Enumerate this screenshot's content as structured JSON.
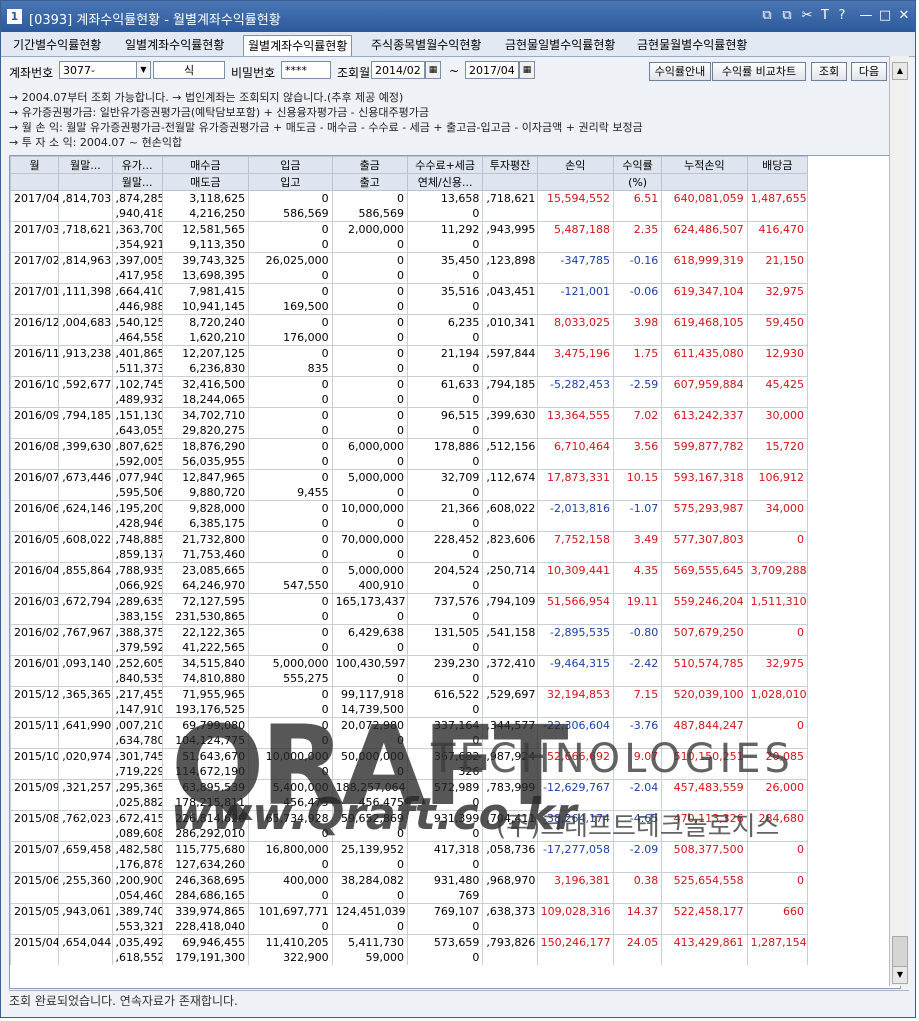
{
  "window": {
    "number": "1",
    "title": "[0393] 계좌수익률현황 - 월별계좌수익률현황",
    "controls": [
      "⧉",
      "⧉",
      "✂",
      "T",
      "?",
      "—",
      "□",
      "✕"
    ]
  },
  "tabs": [
    "기간별수익률현황",
    "일별계좌수익률현황",
    "월별계좌수익률현황",
    "주식종목별월수익현황",
    "금현물일별수익률현황",
    "금현물월별수익률현황"
  ],
  "active_tab": 2,
  "form": {
    "account_label": "계좌번호",
    "account_value": "3077-",
    "name_value": "식",
    "password_label": "비밀번호",
    "password_value": "****",
    "period_label": "조회월",
    "from_value": "2014/02",
    "to_value": "2017/04",
    "tilde": "~",
    "btn_guide": "수익률안내",
    "btn_compare": "수익률 비교차트",
    "btn_search": "조회",
    "btn_next": "다음"
  },
  "notice": [
    "→ 2004.07부터 조회 가능합니다.  → 법인계좌는 조회되지 않습니다.(추후 제공 예정)",
    "→ 유가증권평가금: 일반유가증권평가금(예탁담보포함) + 신용융자평가금 - 신용대주평가금",
    "→ 월    손    익: 월말 유가증권평가금-전월말 유가증권평가금 + 매도금 - 매수금 - 수수료 - 세금 + 출고금-입고금 - 이자금액 + 권리락 보정금",
    "→ 투 자 소 익: 2004.07 ~ 현손익합"
  ],
  "table": {
    "headers_top": [
      "월",
      "월말...",
      "유가...",
      "매수금",
      "입금",
      "출금",
      "수수료+세금",
      "투자평잔",
      "손익",
      "수익률",
      "누적손익",
      "배당금"
    ],
    "headers_bot": [
      "",
      "",
      "월말...",
      "매도금",
      "입고",
      "출고",
      "연체/신용...",
      "",
      "",
      "(%)",
      "",
      ""
    ],
    "rows": [
      [
        "2017/04",
        ",814,703",
        ",874,285",
        "3,118,625",
        "0",
        "0",
        "13,658",
        ",718,621",
        "15,594,552",
        "6.51",
        "640,081,059",
        "1,487,655",
        ",940,418",
        "4,216,250",
        "586,569",
        "586,569",
        "0"
      ],
      [
        "2017/03",
        ",718,621",
        ",363,700",
        "12,581,565",
        "0",
        "2,000,000",
        "11,292",
        ",943,995",
        "5,487,188",
        "2.35",
        "624,486,507",
        "416,470",
        ",354,921",
        "9,113,350",
        "0",
        "0",
        "0"
      ],
      [
        "2017/02",
        ",814,963",
        ",397,005",
        "39,743,325",
        "26,025,000",
        "0",
        "35,450",
        ",123,898",
        "-347,785",
        "-0.16",
        "618,999,319",
        "21,150",
        ",417,958",
        "13,698,395",
        "0",
        "0",
        "0"
      ],
      [
        "2017/01",
        ",111,398",
        ",664,410",
        "7,981,415",
        "0",
        "0",
        "35,516",
        ",043,451",
        "-121,001",
        "-0.06",
        "619,347,104",
        "32,975",
        ",446,988",
        "10,941,145",
        "169,500",
        "0",
        "0"
      ],
      [
        "2016/12",
        ",004,683",
        ",540,125",
        "8,720,240",
        "0",
        "0",
        "6,235",
        ",010,341",
        "8,033,025",
        "3.98",
        "619,468,105",
        "59,450",
        ",464,558",
        "1,620,210",
        "176,000",
        "0",
        "0"
      ],
      [
        "2016/11",
        ",913,238",
        ",401,865",
        "12,207,125",
        "0",
        "0",
        "21,194",
        ",597,844",
        "3,475,196",
        "1.75",
        "611,435,080",
        "12,930",
        ",511,373",
        "6,236,830",
        "835",
        "0",
        "0"
      ],
      [
        "2016/10",
        ",592,677",
        ",102,745",
        "32,416,500",
        "0",
        "0",
        "61,633",
        ",794,185",
        "-5,282,453",
        "-2.59",
        "607,959,884",
        "45,425",
        ",489,932",
        "18,244,065",
        "0",
        "0",
        "0"
      ],
      [
        "2016/09",
        ",794,185",
        ",151,130",
        "34,702,710",
        "0",
        "0",
        "96,515",
        ",399,630",
        "13,364,555",
        "7.02",
        "613,242,337",
        "30,000",
        ",643,055",
        "29,820,275",
        "0",
        "0",
        "0"
      ],
      [
        "2016/08",
        ",399,630",
        ",807,625",
        "18,876,290",
        "0",
        "6,000,000",
        "178,886",
        ",512,156",
        "6,710,464",
        "3.56",
        "599,877,782",
        "15,720",
        ",592,005",
        "56,035,955",
        "0",
        "0",
        "0"
      ],
      [
        "2016/07",
        ",673,446",
        ",077,940",
        "12,847,965",
        "0",
        "5,000,000",
        "32,709",
        ",112,674",
        "17,873,331",
        "10.15",
        "593,167,318",
        "106,912",
        ",595,506",
        "9,880,720",
        "9,455",
        "0",
        "0"
      ],
      [
        "2016/06",
        ",624,146",
        ",195,200",
        "9,828,000",
        "0",
        "10,000,000",
        "21,366",
        ",608,022",
        "-2,013,816",
        "-1.07",
        "575,293,987",
        "34,000",
        ",428,946",
        "6,385,175",
        "0",
        "0",
        "0"
      ],
      [
        "2016/05",
        ",608,022",
        ",748,885",
        "21,732,800",
        "0",
        "70,000,000",
        "228,452",
        ",823,606",
        "7,752,158",
        "3.49",
        "577,307,803",
        "0",
        ",859,137",
        "71,753,460",
        "0",
        "0",
        "0"
      ],
      [
        "2016/04",
        ",855,864",
        ",788,935",
        "23,085,665",
        "0",
        "5,000,000",
        "204,524",
        ",250,714",
        "10,309,441",
        "4.35",
        "569,555,645",
        "3,709,288",
        ",066,929",
        "64,246,970",
        "547,550",
        "400,910",
        "0"
      ],
      [
        "2016/03",
        ",672,794",
        ",289,635",
        "72,127,595",
        "0",
        "165,173,437",
        "737,576",
        ",794,109",
        "51,566,954",
        "19.11",
        "559,246,204",
        "1,511,310",
        ",383,159",
        "231,530,865",
        "0",
        "0",
        "0"
      ],
      [
        "2016/02",
        ",767,967",
        ",388,375",
        "22,122,365",
        "0",
        "6,429,638",
        "131,505",
        ",541,158",
        "-2,895,535",
        "-0.80",
        "507,679,250",
        "0",
        ",379,592",
        "41,222,565",
        "0",
        "0",
        "0"
      ],
      [
        "2016/01",
        ",093,140",
        ",252,605",
        "34,515,840",
        "5,000,000",
        "100,430,597",
        "239,230",
        ",372,410",
        "-9,464,315",
        "-2.42",
        "510,574,785",
        "32,975",
        ",840,535",
        "74,810,880",
        "555,275",
        "0",
        "0"
      ],
      [
        "2015/12",
        ",365,365",
        ",217,455",
        "71,955,965",
        "0",
        "99,117,918",
        "616,522",
        ",529,697",
        "32,194,853",
        "7.15",
        "520,039,100",
        "1,028,010",
        ",147,910",
        "193,176,525",
        "0",
        "14,739,500",
        "0"
      ],
      [
        "2015/11",
        ",641,990",
        ",007,210",
        "69,799,080",
        "0",
        "20,072,980",
        "337,164",
        ",344,577",
        "-22,306,604",
        "-3.76",
        "487,844,247",
        "0",
        ",634,780",
        "104,124,775",
        "0",
        "0",
        "0"
      ],
      [
        "2015/10",
        ",020,974",
        ",301,745",
        "51,643,670",
        "10,000,000",
        "50,000,000",
        "367,682",
        ",987,924",
        "52,666,692",
        "9.07",
        "510,150,251",
        "20,085",
        ",719,229",
        "114,672,190",
        "0",
        "0",
        "326"
      ],
      [
        "2015/09",
        ",321,257",
        ",295,365",
        "63,895,539",
        "5,400,000",
        "188,257,064",
        "572,989",
        ",783,999",
        "-12,629,767",
        "-2.04",
        "457,483,559",
        "26,000",
        ",025,882",
        "178,215,811",
        "456,475",
        "456,475",
        "0"
      ],
      [
        "2015/08",
        ",762,023",
        ",672,415",
        "226,814,620",
        "65,734,928",
        "59,652,869",
        "931,399",
        ",704,411",
        "-38,264,174",
        "-4.65",
        "470,113,326",
        "284,680",
        ",089,608",
        "286,292,010",
        "0",
        "0",
        "0"
      ],
      [
        "2015/07",
        ",659,458",
        ",482,580",
        "115,775,680",
        "16,800,000",
        "25,139,952",
        "417,318",
        ",058,736",
        "-17,277,058",
        "-2.09",
        "508,377,500",
        "0",
        ",176,878",
        "127,634,260",
        "0",
        "0",
        "0"
      ],
      [
        "2015/06",
        ",255,360",
        ",200,900",
        "246,368,695",
        "400,000",
        "38,284,082",
        "931,480",
        ",968,970",
        "3,196,381",
        "0.38",
        "525,654,558",
        "0",
        ",054,460",
        "284,686,165",
        "0",
        "0",
        "769"
      ],
      [
        "2015/05",
        ",943,061",
        ",389,740",
        "339,974,865",
        "101,697,771",
        "124,451,039",
        "769,107",
        ",638,373",
        "109,028,316",
        "14.37",
        "522,458,177",
        "660",
        ",553,321",
        "228,418,040",
        "0",
        "0",
        "0"
      ],
      [
        "2015/04",
        ",654,044",
        ",035,492",
        "69,946,455",
        "11,410,205",
        "5,411,730",
        "573,659",
        ",793,826",
        "150,246,177",
        "24.05",
        "413,429,861",
        "1,287,154",
        ",618,552",
        "179,191,300",
        "322,900",
        "59,000",
        "0"
      ]
    ]
  },
  "watermark": {
    "brand": "QRAFT",
    "tech": "TECHNOLOGIES",
    "url": "www.Qraft.co.kr",
    "korean": "(주)크래프트테크놀로지스"
  },
  "status": "조회 완료되었습니다. 연속자료가 존재합니다."
}
